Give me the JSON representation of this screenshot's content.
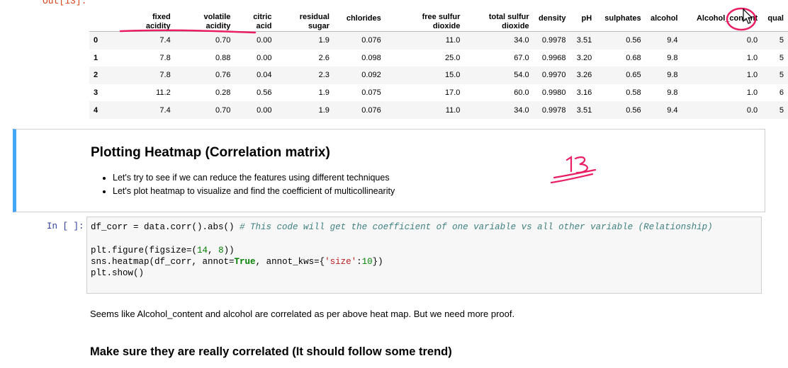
{
  "output_prompt": "Out[13]:",
  "table": {
    "columns": [
      "",
      "fixed acidity",
      "volatile acidity",
      "citric acid",
      "residual sugar",
      "chlorides",
      "free sulfur dioxide",
      "total sulfur dioxide",
      "density",
      "pH",
      "sulphates",
      "alcohol",
      "Alcohol_content",
      "quality"
    ],
    "header_lines": [
      [
        "",
        ""
      ],
      [
        "fixed",
        "acidity"
      ],
      [
        "volatile",
        "acidity"
      ],
      [
        "citric",
        "acid"
      ],
      [
        "residual",
        "sugar"
      ],
      [
        "",
        "chlorides"
      ],
      [
        "free sulfur",
        "dioxide"
      ],
      [
        "total sulfur",
        "dioxide"
      ],
      [
        "",
        "density"
      ],
      [
        "",
        "pH"
      ],
      [
        "",
        "sulphates"
      ],
      [
        "",
        "alcohol"
      ],
      [
        "",
        "Alcohol_content"
      ],
      [
        "",
        "qual"
      ]
    ],
    "rows": [
      [
        "0",
        "7.4",
        "0.70",
        "0.00",
        "1.9",
        "0.076",
        "11.0",
        "34.0",
        "0.9978",
        "3.51",
        "0.56",
        "9.4",
        "0.0",
        "5"
      ],
      [
        "1",
        "7.8",
        "0.88",
        "0.00",
        "2.6",
        "0.098",
        "25.0",
        "67.0",
        "0.9968",
        "3.20",
        "0.68",
        "9.8",
        "1.0",
        "5"
      ],
      [
        "2",
        "7.8",
        "0.76",
        "0.04",
        "2.3",
        "0.092",
        "15.0",
        "54.0",
        "0.9970",
        "3.26",
        "0.65",
        "9.8",
        "1.0",
        "5"
      ],
      [
        "3",
        "11.2",
        "0.28",
        "0.56",
        "1.9",
        "0.075",
        "17.0",
        "60.0",
        "0.9980",
        "3.16",
        "0.58",
        "9.8",
        "1.0",
        "6"
      ],
      [
        "4",
        "7.4",
        "0.70",
        "0.00",
        "1.9",
        "0.076",
        "11.0",
        "34.0",
        "0.9978",
        "3.51",
        "0.56",
        "9.4",
        "0.0",
        "5"
      ]
    ]
  },
  "markdown": {
    "heading": "Plotting Heatmap (Correlation matrix)",
    "bullets": [
      "Let's try to see if we can reduce the features using different techniques",
      "Let's plot heatmap to visualize and find the coefficient of multicollinearity"
    ]
  },
  "code_cell": {
    "prompt": "In [ ]:",
    "line1_code": "df_corr = data.corr().abs() ",
    "line1_comment": "# This code will get the coefficient of one variable vs all other variable (Relationship)",
    "line3_a": "plt.figure(figsize=(",
    "line3_n1": "14",
    "line3_b": ", ",
    "line3_n2": "8",
    "line3_c": "))",
    "line4_a": "sns.heatmap(df_corr, annot=",
    "line4_true": "True",
    "line4_b": ", annot_kws={",
    "line4_str": "'size'",
    "line4_c": ":",
    "line4_num": "10",
    "line4_d": "})",
    "line5": "plt.show()"
  },
  "paragraph": "Seems like Alcohol_content and alcohol are correlated as per above heat map. But we need more proof.",
  "subheading": "Make sure they are really correlated (It should follow some trend)",
  "annotation_text": "13",
  "colors": {
    "accent_blue": "#42a5f5",
    "annotation_pink": "#e91e63",
    "prompt_in": "#303f9f",
    "prompt_out": "#d84315"
  }
}
